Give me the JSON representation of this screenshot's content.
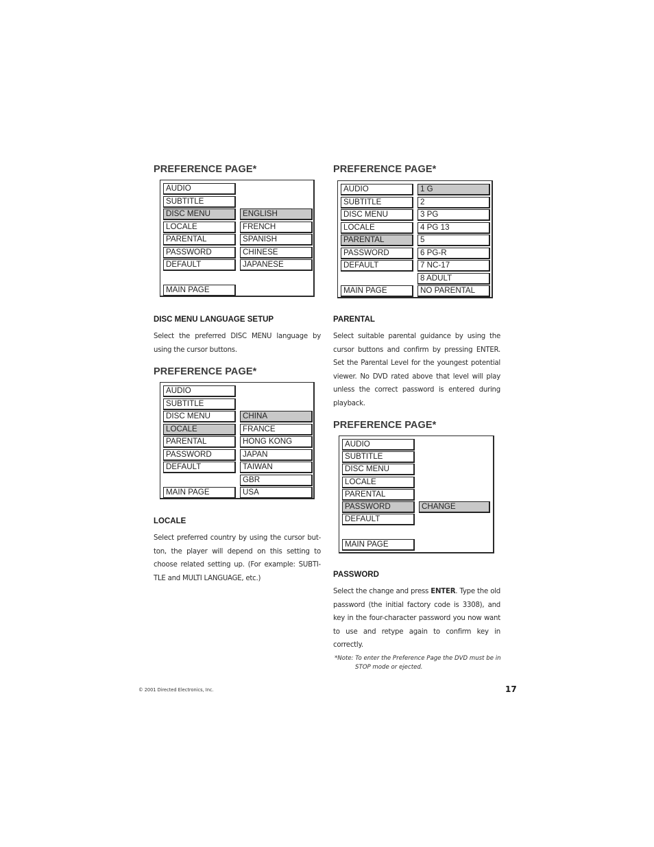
{
  "panels": [
    {
      "title": "PREFERENCE PAGE*",
      "menu": [
        "AUDIO",
        "SUBTITLE",
        "DISC MENU",
        "LOCALE",
        "PARENTAL",
        "PASSWORD",
        "DEFAULT"
      ],
      "main_page": "MAIN PAGE",
      "selected_menu": "DISC MENU",
      "options": [
        "ENGLISH",
        "FRENCH",
        "SPANISH",
        "CHINESE",
        "JAPANESE"
      ],
      "selected_option": "ENGLISH"
    },
    {
      "title": "PREFERENCE PAGE*",
      "menu": [
        "AUDIO",
        "SUBTITLE",
        "DISC MENU",
        "LOCALE",
        "PARENTAL",
        "PASSWORD",
        "DEFAULT"
      ],
      "main_page": "MAIN PAGE",
      "selected_menu": "PARENTAL",
      "options": [
        "1 G",
        "2",
        "3 PG",
        "4 PG 13",
        "5",
        "6 PG-R",
        "7 NC-17",
        "8 ADULT",
        "NO PARENTAL"
      ],
      "selected_option": "1 G"
    },
    {
      "title": "PREFERENCE PAGE*",
      "menu": [
        "AUDIO",
        "SUBTITLE",
        "DISC MENU",
        "LOCALE",
        "PARENTAL",
        "PASSWORD",
        "DEFAULT"
      ],
      "main_page": "MAIN PAGE",
      "selected_menu": "LOCALE",
      "options": [
        "CHINA",
        "FRANCE",
        "HONG KONG",
        "JAPAN",
        "TAIWAN",
        "GBR",
        "USA"
      ],
      "selected_option": "CHINA"
    },
    {
      "title": "PREFERENCE PAGE*",
      "menu": [
        "AUDIO",
        "SUBTITLE",
        "DISC MENU",
        "LOCALE",
        "PARENTAL",
        "PASSWORD",
        "DEFAULT"
      ],
      "main_page": "MAIN PAGE",
      "selected_menu": "PASSWORD",
      "options": [
        "CHANGE"
      ],
      "selected_option": "CHANGE"
    }
  ],
  "sections": {
    "disc_menu": {
      "heading": "DISC MENU LANGUAGE SETUP",
      "body": "Select the preferred DISC MENU language by using the cursor buttons."
    },
    "parental": {
      "heading": "PARENTAL",
      "body": "Select suitable parental guidance by using the cursor buttons and confirm by pressing ENTER. Set the Parental Level for the youngest potential viewer. No DVD rated above that level will play unless the correct password is entered during playback."
    },
    "locale": {
      "heading": "LOCALE",
      "body": "Select preferred country by using the cursor but-ton, the player will depend on this setting to choose related setting up. (For example: SUBTI-TLE and MULTI LANGUAGE, etc.)"
    },
    "password": {
      "heading": "PASSWORD",
      "body_pre": "Select the change and press ",
      "body_kw": "ENTER",
      "body_post": ". Type the old password (the initial factory code is 3308), and key in the four-character password you now want to use and retype again to confirm key in correctly."
    }
  },
  "footnote": {
    "line1": "*Note: To enter the Preference Page the DVD must be in",
    "line2": "STOP mode or ejected."
  },
  "footer": {
    "copyright": "© 2001 Directed Electronics, Inc.",
    "page_number": "17"
  },
  "colors": {
    "selected_fill": "#c8c8c8",
    "border": "#222222"
  }
}
